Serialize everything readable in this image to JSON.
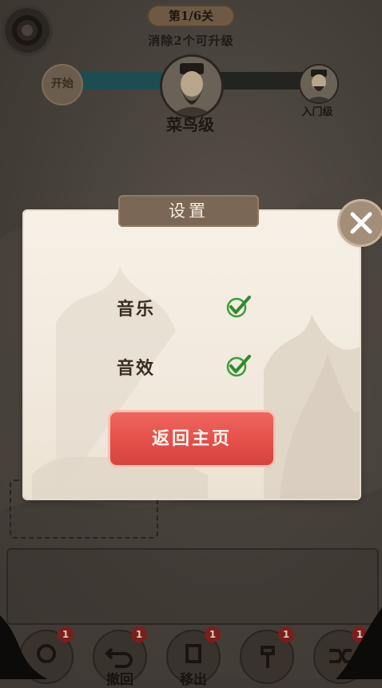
{
  "hud": {
    "level_tag": "第1/6关",
    "goal_text": "消除2个可升级",
    "start_badge": "开始",
    "current_rank": "菜鸟级",
    "next_rank": "入门级",
    "progress": 0.45
  },
  "toolbar": {
    "tools": [
      {
        "badge": "1",
        "label": "",
        "icon": "hint-icon"
      },
      {
        "badge": "1",
        "label": "撤回",
        "icon": "undo-icon"
      },
      {
        "badge": "1",
        "label": "移出",
        "icon": "remove-icon"
      },
      {
        "badge": "1",
        "label": "",
        "icon": "hammer-icon"
      },
      {
        "badge": "1",
        "label": "",
        "icon": "shuffle-icon"
      }
    ]
  },
  "dialog": {
    "title": "设置",
    "options": [
      {
        "label": "音乐",
        "checked": true
      },
      {
        "label": "音效",
        "checked": true
      }
    ],
    "home_button": "返回主页"
  },
  "colors": {
    "accent_red": "#e4504a",
    "check_green": "#3b9d3a",
    "title_plate": "#7b6755"
  }
}
